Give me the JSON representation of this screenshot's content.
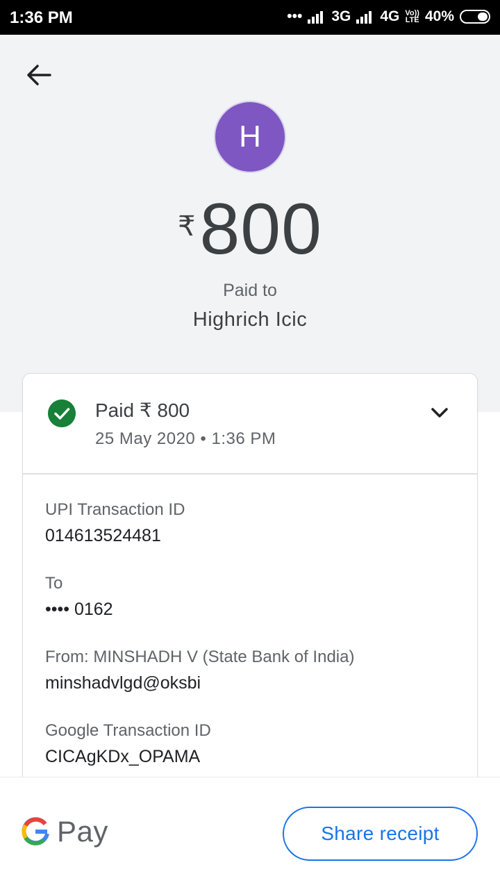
{
  "status_bar": {
    "time": "1:36 PM",
    "network_3g": "3G",
    "network_4g": "4G",
    "volte_top": "Vo))",
    "volte_bottom": "LTE",
    "battery": "40%"
  },
  "header": {
    "avatar_letter": "H",
    "currency_symbol": "₹",
    "amount": "800",
    "paid_to_label": "Paid to",
    "payee_name": "Highrich Icic"
  },
  "transaction": {
    "status_title": "Paid ₹ 800",
    "date_time": "25 May 2020 • 1:36 PM",
    "details": [
      {
        "label": "UPI Transaction ID",
        "value": "014613524481"
      },
      {
        "label": "To",
        "value": "•••• 0162"
      },
      {
        "label": "From: MINSHADH  V (State Bank of India)",
        "value": "minshadvlgd@oksbi"
      },
      {
        "label": "Google Transaction ID",
        "value": "CICAgKDx_OPAMA"
      }
    ]
  },
  "footer": {
    "brand": "Pay",
    "share_label": "Share receipt"
  },
  "colors": {
    "avatar": "#7e57c2",
    "success": "#188038",
    "accent": "#1a73e8",
    "hero_bg": "#f1f3f4"
  }
}
